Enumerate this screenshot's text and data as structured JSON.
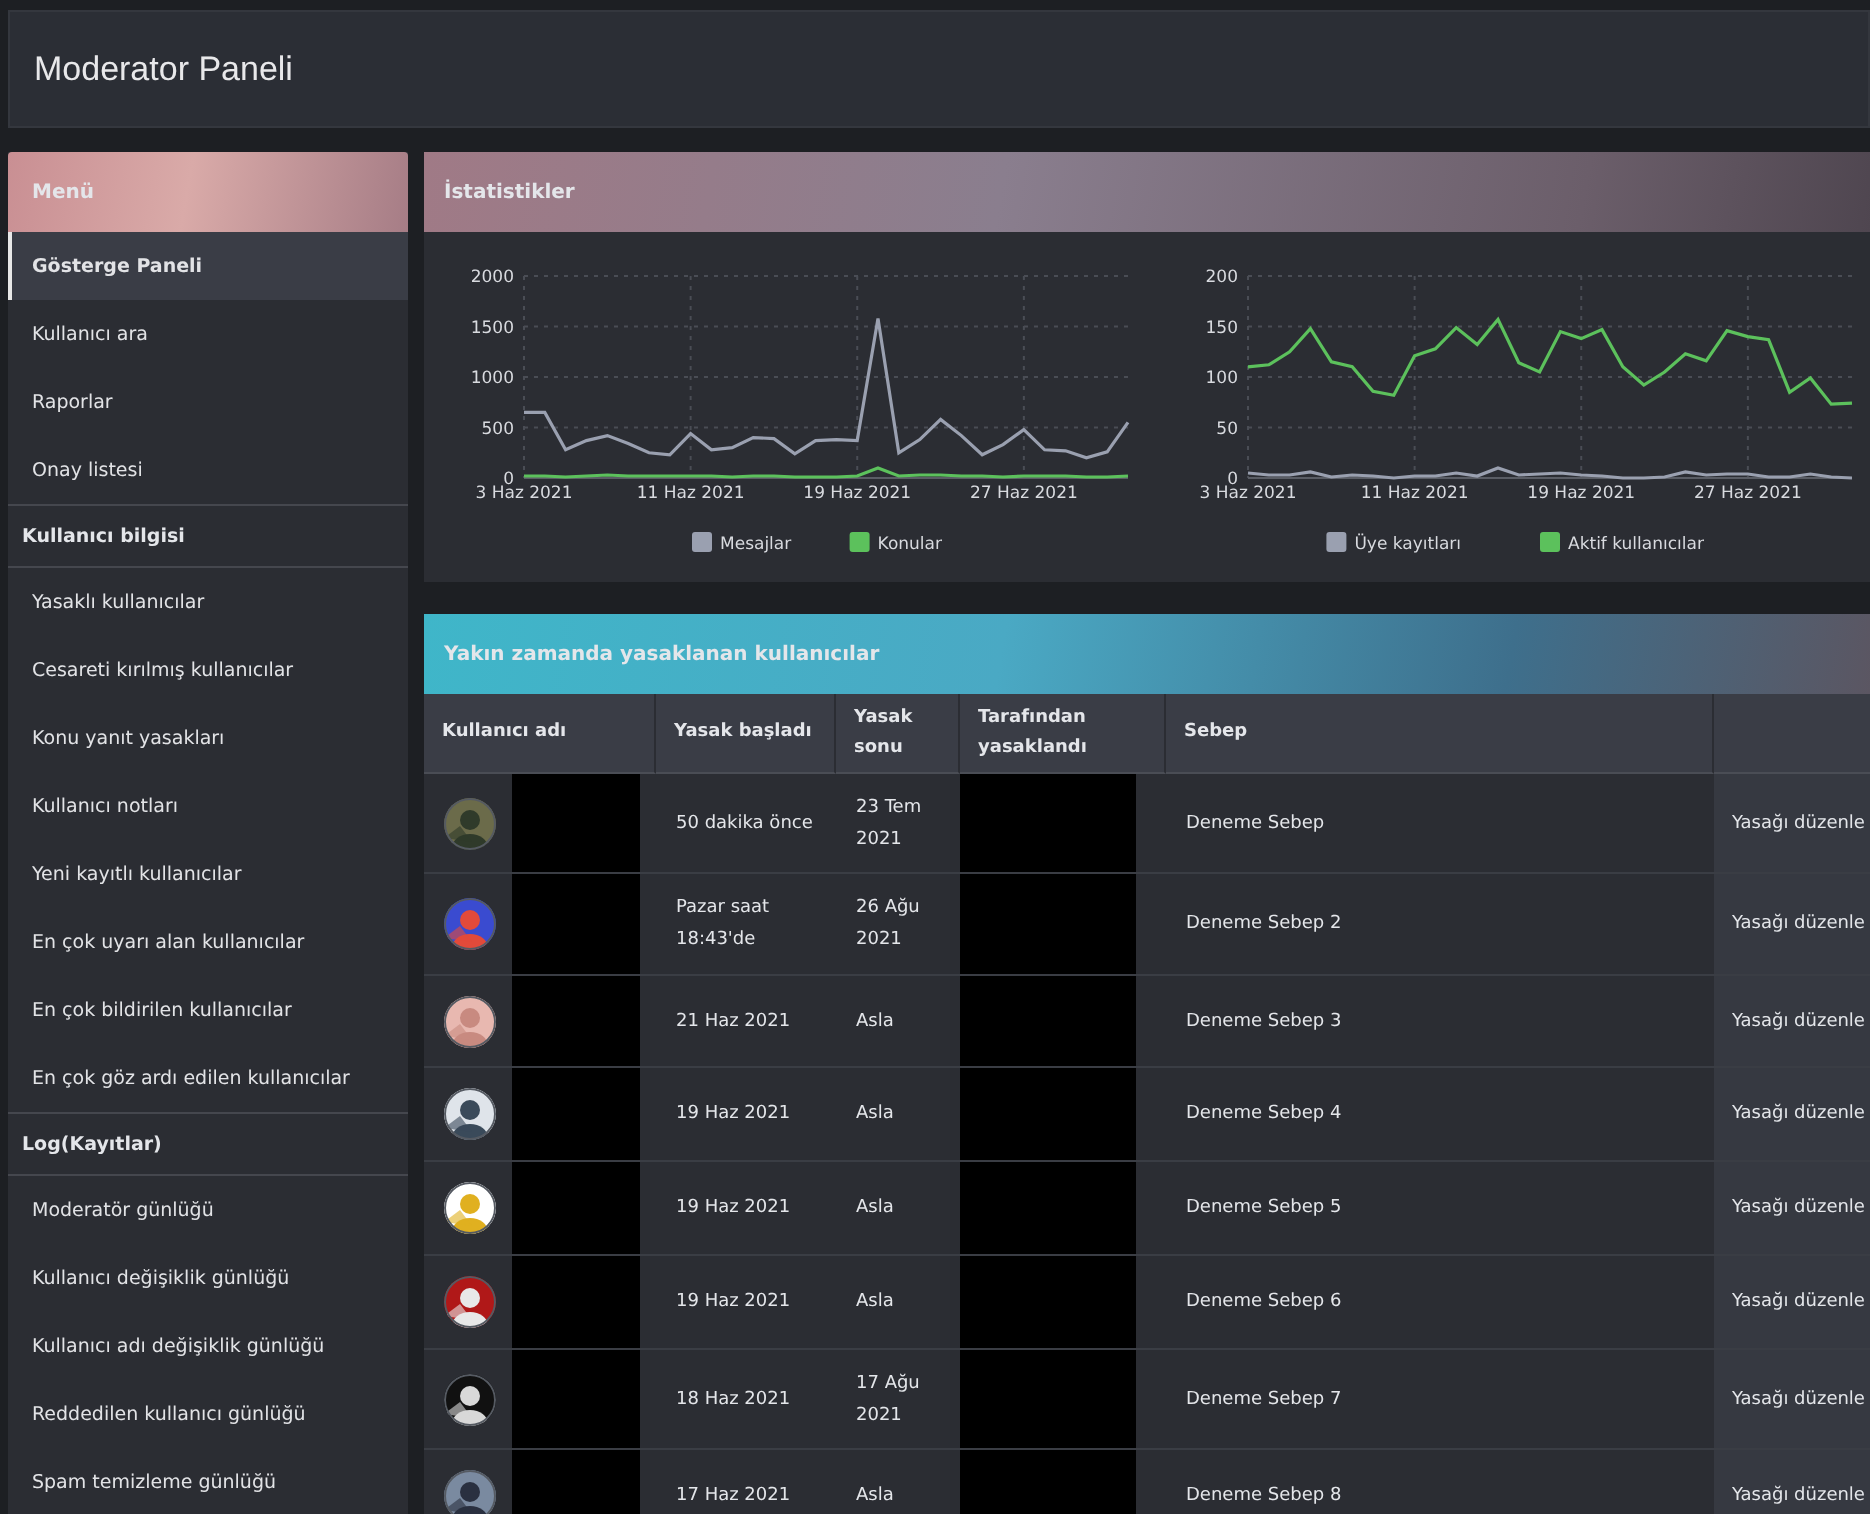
{
  "header": {
    "title": "Moderator Paneli"
  },
  "sidebar": {
    "title": "Menü",
    "items": [
      {
        "kind": "link",
        "label": "Gösterge Paneli",
        "selected": true
      },
      {
        "kind": "link",
        "label": "Kullanıcı ara",
        "selected": false
      },
      {
        "kind": "link",
        "label": "Raporlar",
        "selected": false
      },
      {
        "kind": "link",
        "label": "Onay listesi",
        "selected": false
      },
      {
        "kind": "section",
        "label": "Kullanıcı bilgisi"
      },
      {
        "kind": "link",
        "label": "Yasaklı kullanıcılar",
        "selected": false
      },
      {
        "kind": "link",
        "label": "Cesareti kırılmış kullanıcılar",
        "selected": false
      },
      {
        "kind": "link",
        "label": "Konu yanıt yasakları",
        "selected": false
      },
      {
        "kind": "link",
        "label": "Kullanıcı notları",
        "selected": false
      },
      {
        "kind": "link",
        "label": "Yeni kayıtlı kullanıcılar",
        "selected": false
      },
      {
        "kind": "link",
        "label": "En çok uyarı alan kullanıcılar",
        "selected": false
      },
      {
        "kind": "link",
        "label": "En çok bildirilen kullanıcılar",
        "selected": false
      },
      {
        "kind": "link",
        "label": "En çok göz ardı edilen kullanıcılar",
        "selected": false
      },
      {
        "kind": "section",
        "label": "Log(Kayıtlar)"
      },
      {
        "kind": "link",
        "label": "Moderatör günlüğü",
        "selected": false
      },
      {
        "kind": "link",
        "label": "Kullanıcı değişiklik günlüğü",
        "selected": false
      },
      {
        "kind": "link",
        "label": "Kullanıcı adı değişiklik günlüğü",
        "selected": false
      },
      {
        "kind": "link",
        "label": "Reddedilen kullanıcı günlüğü",
        "selected": false
      },
      {
        "kind": "link",
        "label": "Spam temizleme günlüğü",
        "selected": false
      }
    ]
  },
  "stats": {
    "title": "İstatistikler",
    "charts": [
      {
        "chart_data": {
          "type": "line",
          "categories": [
            "3 Haz 2021",
            null,
            null,
            null,
            null,
            null,
            null,
            null,
            "11 Haz 2021",
            null,
            null,
            null,
            null,
            null,
            null,
            null,
            "19 Haz 2021",
            null,
            null,
            null,
            null,
            null,
            null,
            null,
            "27 Haz 2021",
            null,
            null,
            null,
            null,
            null
          ],
          "grid": true,
          "legend": "bottom",
          "ylim": [
            0,
            2000
          ],
          "yticks": [
            0,
            500,
            1000,
            1500,
            2000
          ],
          "series": [
            {
              "name": "Mesajlar",
              "color": "#9aa0b0",
              "values": [
                650,
                650,
                280,
                370,
                420,
                340,
                250,
                230,
                440,
                280,
                300,
                400,
                390,
                240,
                370,
                380,
                370,
                1580,
                250,
                380,
                580,
                420,
                230,
                330,
                480,
                280,
                270,
                200,
                260,
                550
              ]
            },
            {
              "name": "Konular",
              "color": "#5cc15c",
              "values": [
                20,
                20,
                10,
                20,
                30,
                20,
                20,
                20,
                20,
                20,
                10,
                20,
                20,
                10,
                10,
                10,
                20,
                100,
                20,
                30,
                30,
                20,
                20,
                10,
                20,
                20,
                20,
                10,
                10,
                20
              ]
            }
          ]
        }
      },
      {
        "chart_data": {
          "type": "line",
          "categories": [
            "3 Haz 2021",
            null,
            null,
            null,
            null,
            null,
            null,
            null,
            "11 Haz 2021",
            null,
            null,
            null,
            null,
            null,
            null,
            null,
            "19 Haz 2021",
            null,
            null,
            null,
            null,
            null,
            null,
            null,
            "27 Haz 2021",
            null,
            null,
            null,
            null,
            null
          ],
          "grid": true,
          "legend": "bottom",
          "ylim": [
            0,
            200
          ],
          "yticks": [
            0,
            50,
            100,
            150,
            200
          ],
          "series": [
            {
              "name": "Üye kayıtları",
              "color": "#9aa0b0",
              "values": [
                5,
                3,
                3,
                6,
                1,
                3,
                2,
                0,
                2,
                2,
                5,
                2,
                10,
                3,
                4,
                5,
                3,
                2,
                0,
                0,
                1,
                6,
                3,
                4,
                4,
                1,
                1,
                4,
                1,
                0
              ]
            },
            {
              "name": "Aktif kullanıcılar",
              "color": "#5cc15c",
              "values": [
                110,
                112,
                125,
                148,
                115,
                110,
                86,
                82,
                121,
                128,
                149,
                132,
                157,
                114,
                105,
                145,
                138,
                147,
                110,
                92,
                105,
                123,
                116,
                146,
                140,
                137,
                85,
                99,
                73,
                74
              ]
            }
          ]
        }
      }
    ]
  },
  "bans": {
    "title": "Yakın zamanda yasaklanan kullanıcılar",
    "columns": [
      "Kullanıcı adı",
      "Yasak başladı",
      "Yasak sonu",
      "Tarafından yasaklandı",
      "Sebep"
    ],
    "rows": [
      {
        "started": "50 dakika önce",
        "ends": "23 Tem 2021",
        "reason": "Deneme Sebep",
        "action": "Yasağı düzenle"
      },
      {
        "started": "Pazar saat 18:43'de",
        "ends": "26 Ağu 2021",
        "reason": "Deneme Sebep 2",
        "action": "Yasağı düzenle"
      },
      {
        "started": "21 Haz 2021",
        "ends": "Asla",
        "reason": "Deneme Sebep 3",
        "action": "Yasağı düzenle"
      },
      {
        "started": "19 Haz 2021",
        "ends": "Asla",
        "reason": "Deneme Sebep 4",
        "action": "Yasağı düzenle"
      },
      {
        "started": "19 Haz 2021",
        "ends": "Asla",
        "reason": "Deneme Sebep 5",
        "action": "Yasağı düzenle"
      },
      {
        "started": "19 Haz 2021",
        "ends": "Asla",
        "reason": "Deneme Sebep 6",
        "action": "Yasağı düzenle"
      },
      {
        "started": "18 Haz 2021",
        "ends": "17 Ağu 2021",
        "reason": "Deneme Sebep 7",
        "action": "Yasağı düzenle"
      },
      {
        "started": "17 Haz 2021",
        "ends": "Asla",
        "reason": "Deneme Sebep 8",
        "action": "Yasağı düzenle"
      }
    ]
  }
}
